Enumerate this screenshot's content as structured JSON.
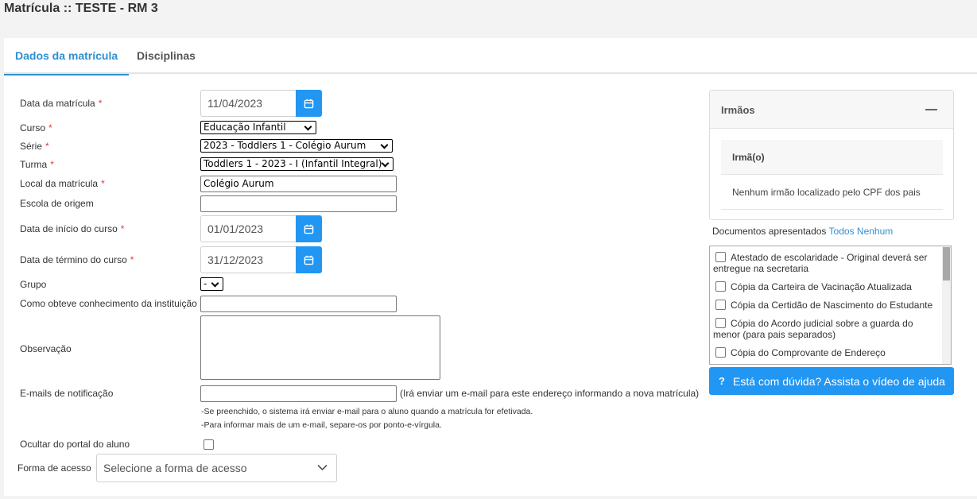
{
  "page": {
    "title": "Matrícula :: TESTE - RM 3"
  },
  "tabs": [
    {
      "label": "Dados da matrícula",
      "active": true
    },
    {
      "label": "Disciplinas",
      "active": false
    }
  ],
  "form": {
    "data_matricula": {
      "label": "Data da matrícula",
      "value": "11/04/2023"
    },
    "curso": {
      "label": "Curso",
      "value": "Educação Infantil"
    },
    "serie": {
      "label": "Série",
      "value": "2023 - Toddlers 1 - Colégio Aurum"
    },
    "turma": {
      "label": "Turma",
      "value": "Toddlers 1 - 2023 - I (Infantil Integral)"
    },
    "local": {
      "label": "Local da matrícula",
      "value": "Colégio Aurum"
    },
    "escola_origem": {
      "label": "Escola de origem",
      "value": ""
    },
    "data_inicio": {
      "label": "Data de início do curso",
      "value": "01/01/2023"
    },
    "data_termino": {
      "label": "Data de término do curso",
      "value": "31/12/2023"
    },
    "grupo": {
      "label": "Grupo",
      "value": "-"
    },
    "conhecimento": {
      "label": "Como obteve conhecimento da instituição",
      "value": ""
    },
    "observacao": {
      "label": "Observação",
      "value": ""
    },
    "emails": {
      "label": "E-mails de notificação",
      "value": "",
      "note": "(Irá enviar um e-mail para este endereço informando a nova matrícula)",
      "hint1": "-Se preenchido, o sistema irá enviar e-mail para o aluno quando a matrícula for efetivada.",
      "hint2": "-Para informar mais de um e-mail, separe-os por ponto-e-vírgula."
    },
    "ocultar": {
      "label": "Ocultar do portal do aluno",
      "checked": false
    },
    "forma_acesso": {
      "label": "Forma de acesso",
      "placeholder": "Selecione a forma de acesso"
    },
    "required_mark": "*"
  },
  "irmaos": {
    "title": "Irmãos",
    "column": "Irmã(o)",
    "empty": "Nenhum irmão localizado pelo CPF dos pais"
  },
  "documentos": {
    "label": "Documentos apresentados",
    "all_link": "Todos",
    "none_link": "Nenhum",
    "items": [
      "Atestado de escolaridade - Original deverá ser entregue na secretaria",
      "Cópia da Carteira de Vacinação Atualizada",
      "Cópia da Certidão de Nascimento do Estudante",
      "Cópia do Acordo judicial sobre a guarda do menor (para pais separados)",
      "Cópia do Comprovante de Endereço"
    ]
  },
  "help": {
    "icon": "?",
    "label": "Está com dúvida? Assista o vídeo de ajuda"
  },
  "colors": {
    "accent": "#2196f3",
    "link": "#2f8fd1",
    "required": "#e53935"
  }
}
